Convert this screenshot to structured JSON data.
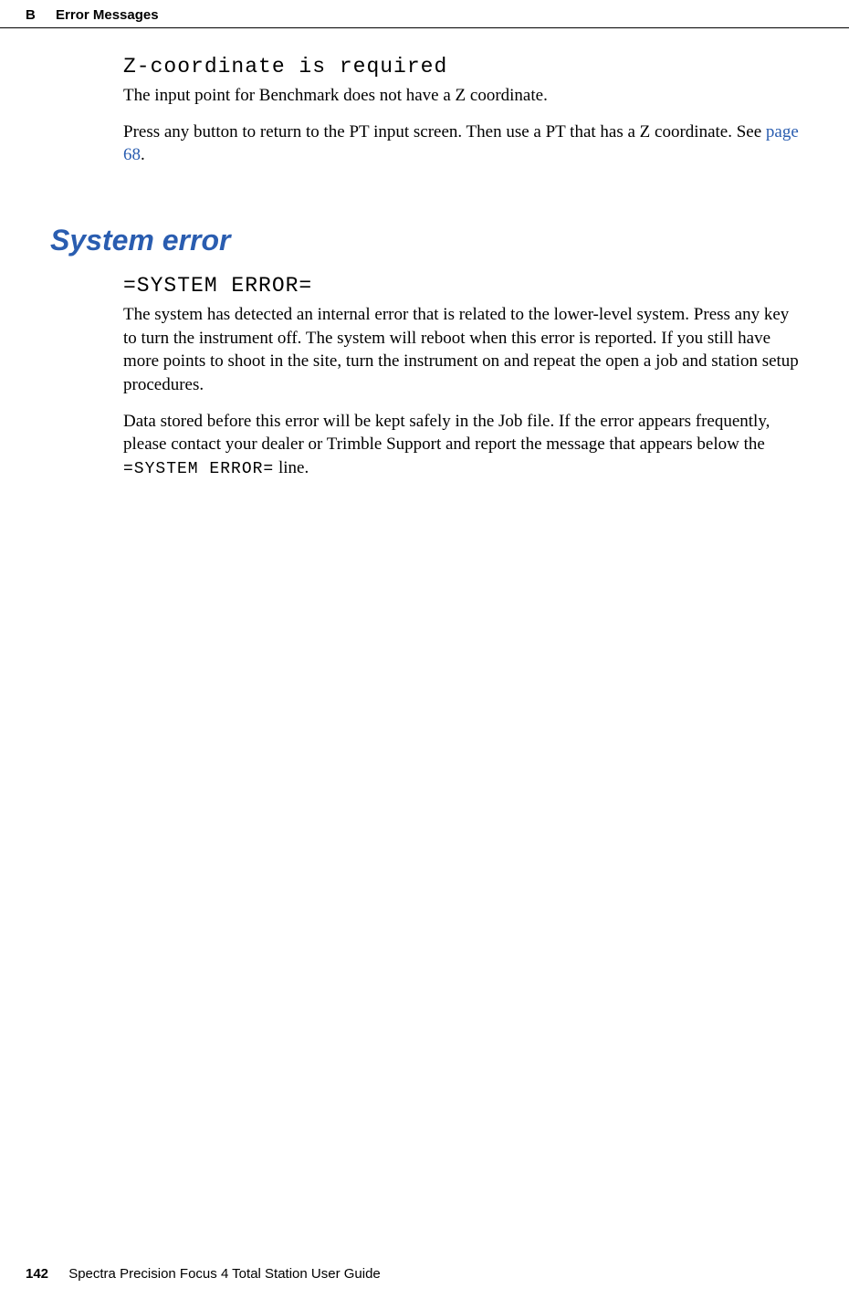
{
  "header": {
    "sectionLetter": "B",
    "sectionTitle": "Error Messages"
  },
  "section1": {
    "lcdTitle": "Z-coordinate is required",
    "p1": "The input point for Benchmark does not have a Z coordinate.",
    "p2a": "Press any button to return to the PT input screen. Then use a PT that has a Z coordinate. See ",
    "p2link": "page 68",
    "p2b": "."
  },
  "heading2": "System error",
  "section2": {
    "lcdTitle": "=SYSTEM ERROR=",
    "p1": "The system has detected an internal error that is related to the lower-level system. Press any key to turn the instrument off. The system will reboot when this error is reported. If you still have more points to shoot in the site, turn the instrument on and repeat the open a job and station setup procedures.",
    "p2a": "Data stored before this error will be kept safely in the Job file. If the error appears frequently, please contact your dealer or Trimble Support and report the message that appears below the ",
    "p2mono": "=SYSTEM ERROR=",
    "p2b": " line."
  },
  "footer": {
    "pageNumber": "142",
    "guideTitle": "Spectra Precision Focus 4 Total Station User Guide"
  }
}
